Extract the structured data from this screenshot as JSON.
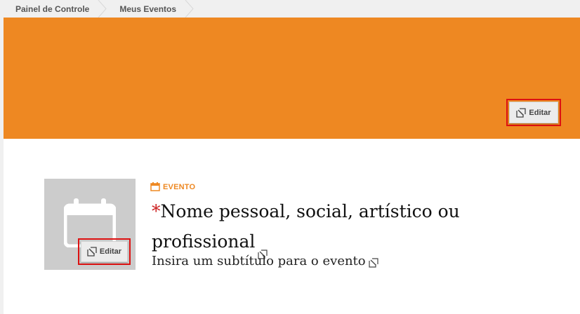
{
  "breadcrumb": {
    "items": [
      {
        "label": "Painel de Controle"
      },
      {
        "label": "Meus Eventos"
      }
    ]
  },
  "cover": {
    "color": "#ee8822",
    "edit_label": "Editar"
  },
  "event": {
    "type_icon": "calendar-icon",
    "type_label": "EVENTO",
    "required_mark": "*",
    "title_placeholder": "Nome pessoal, social, artístico ou profissional",
    "subtitle_placeholder": "Insira um subtítulo para o evento",
    "avatar_edit_label": "Editar",
    "accent_color": "#ee8822",
    "highlight_color": "#dd1111"
  }
}
